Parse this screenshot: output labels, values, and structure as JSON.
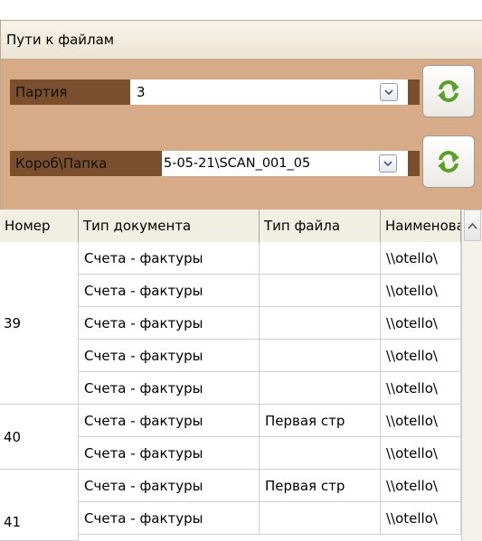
{
  "panel": {
    "title": "Пути к файлам"
  },
  "filters": {
    "batch": {
      "label": "Партия",
      "value": "3"
    },
    "box": {
      "label": "Короб\\Папка",
      "value": "5-05-21\\SCAN_001_05"
    }
  },
  "table": {
    "columns": [
      "Номер",
      "Тип документа",
      "Тип файла",
      "Наименование"
    ],
    "groups": [
      {
        "number": "39",
        "rows": [
          {
            "doc_type": "Счета - фактуры",
            "file_type": "",
            "name": "\\\\otello\\"
          },
          {
            "doc_type": "Счета - фактуры",
            "file_type": "",
            "name": "\\\\otello\\"
          },
          {
            "doc_type": "Счета - фактуры",
            "file_type": "",
            "name": "\\\\otello\\"
          },
          {
            "doc_type": "Счета - фактуры",
            "file_type": "",
            "name": "\\\\otello\\"
          },
          {
            "doc_type": "Счета - фактуры",
            "file_type": "",
            "name": "\\\\otello\\"
          }
        ]
      },
      {
        "number": "40",
        "rows": [
          {
            "doc_type": "Счета - фактуры",
            "file_type": "Первая стр",
            "name": "\\\\otello\\"
          },
          {
            "doc_type": "Счета - фактуры",
            "file_type": "",
            "name": "\\\\otello\\"
          }
        ]
      },
      {
        "number": "41",
        "rows": [
          {
            "doc_type": "Счета - фактуры",
            "file_type": "Первая стр",
            "name": "\\\\otello\\"
          },
          {
            "doc_type": "Счета - фактуры",
            "file_type": "",
            "name": "\\\\otello\\"
          }
        ]
      }
    ]
  },
  "colors": {
    "accent": "#7a4f2d",
    "panel": "#d7aa88",
    "refresh_icon": "#5aa028"
  },
  "icons": {
    "refresh": "refresh-icon",
    "dropdown": "chevron-down-icon",
    "scroll_up": "chevron-up-icon"
  }
}
